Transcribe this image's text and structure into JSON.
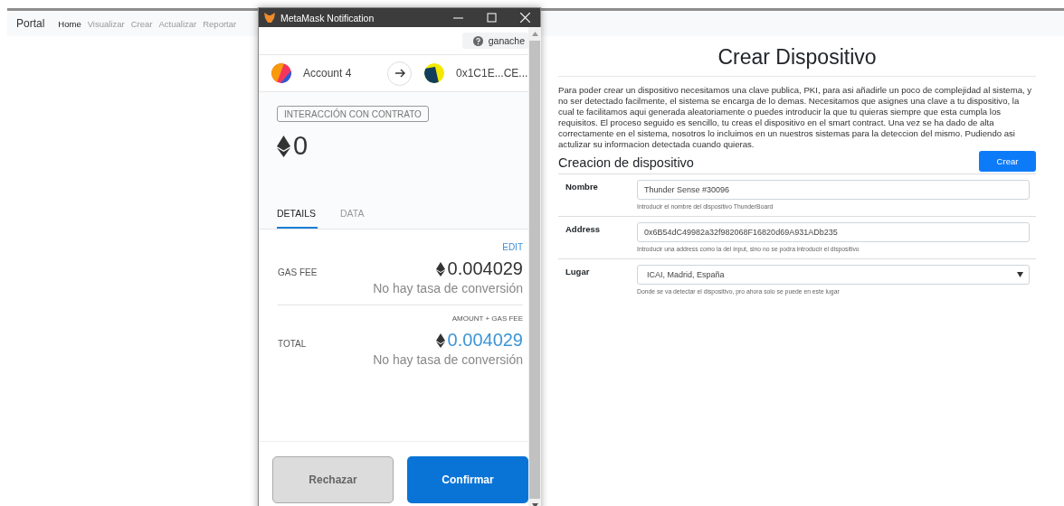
{
  "navbar": {
    "brand": "Portal",
    "links": [
      {
        "label": "Home",
        "selected": true
      },
      {
        "label": "Visualizar",
        "selected": false
      },
      {
        "label": "Crear",
        "selected": false
      },
      {
        "label": "Actualizar",
        "selected": false
      },
      {
        "label": "Reportar",
        "selected": false
      }
    ]
  },
  "page": {
    "title": "Crear Dispositivo",
    "intro": "Para poder crear un dispositivo necesitamos una clave publica, PKI, para asi añadirle un poco de complejidad al sistema, y no ser detectado facilmente, el sistema se encarga de lo demas. Necesitamos que asignes una clave a tu dispositivo, la cual te facilitamos aqui generada aleatoriamente o puedes introducir la que tu quieras siempre que esta cumpla los requisitos. El proceso seguido es sencillo, tu creas el dispositivo en el smart contract. Una vez se ha dado de alta correctamente en el sistema, nosotros lo incluimos en un nuestros sistemas para la deteccion del mismo. Pudiendo asi actulizar su informacion detectada cuando quieras.",
    "section_title": "Creacion de dispositivo",
    "submit": "Crear",
    "fields": [
      {
        "label": "Nombre",
        "kind": "input",
        "value": "Thunder Sense #30096",
        "help": "Introducir el nombre del dispositivo ThunderBoard"
      },
      {
        "label": "Address",
        "kind": "input",
        "value": "0x6B54dC49982a32f982068F16820d69A931ADb235",
        "help": "Introducir una address como la del input, sino no se podra introducir el dispositivo"
      },
      {
        "label": "Lugar",
        "kind": "select",
        "value": "ICAI, Madrid, España",
        "help": "Donde se va detectar el dispositivo, pro ahora solo se puede en este lugar"
      }
    ]
  },
  "metamask": {
    "title": "MetaMask Notification",
    "network": "ganache",
    "from_account": "Account 4",
    "to_account": "0x1C1E...CE...",
    "badge": "INTERACCIÓN CON CONTRATO",
    "amount": "0",
    "tabs": [
      {
        "label": "DETAILS",
        "selected": true
      },
      {
        "label": "DATA",
        "selected": false
      }
    ],
    "edit": "EDIT",
    "gas_fee": {
      "label": "GAS FEE",
      "value": "0.004029",
      "conversion": "No hay tasa de conversión"
    },
    "total": {
      "caption": "AMOUNT + GAS FEE",
      "label": "TOTAL",
      "value": "0.004029",
      "conversion": "No hay tasa de conversión"
    },
    "buttons": [
      {
        "label": "Rechazar",
        "kind": "secondary"
      },
      {
        "label": "Confirmar",
        "kind": "primary"
      }
    ]
  }
}
